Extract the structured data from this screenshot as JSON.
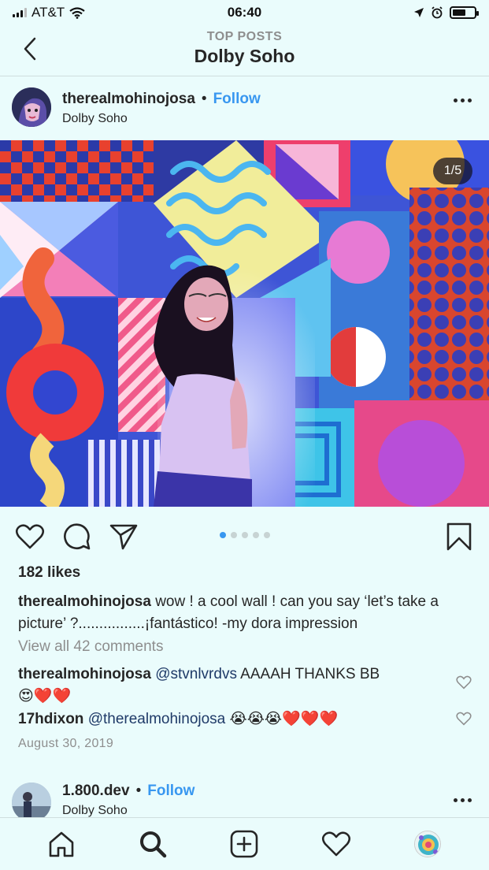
{
  "status": {
    "carrier": "AT&T",
    "time": "06:40",
    "battery_level": 0.6
  },
  "header": {
    "subtitle": "TOP POSTS",
    "title": "Dolby Soho"
  },
  "post": {
    "username": "therealmohinojosa",
    "separator": "•",
    "follow_label": "Follow",
    "location": "Dolby Soho",
    "image_counter": "1/5",
    "carousel_total": 5,
    "carousel_active": 1,
    "likes": "182 likes",
    "caption_user": "therealmohinojosa",
    "caption_text": " wow ! a cool wall ! can you say ‘let’s take a picture’ ?................¡fantástico! -my dora impression",
    "view_all": "View all 42 comments",
    "comments": [
      {
        "user": "therealmohinojosa",
        "mention": "@stvnlvrdvs",
        "text": " AAAAH THANKS BB",
        "emoji": "😍❤️❤️"
      },
      {
        "user": "17hdixon",
        "mention": "@therealmohinojosa",
        "text": " ",
        "emoji": "😭😭😭❤️❤️❤️"
      }
    ],
    "date": "August 30, 2019"
  },
  "next_post": {
    "username": "1.800.dev",
    "separator": "•",
    "follow_label": "Follow",
    "location": "Dolby Soho"
  },
  "colors": {
    "accent": "#3897f0",
    "background": "#eafcfc",
    "muted": "#8e8e8e"
  },
  "icons": [
    "back-arrow-icon",
    "more-icon",
    "heart-icon",
    "comment-icon",
    "share-icon",
    "bookmark-icon",
    "home-icon",
    "search-icon",
    "add-icon",
    "activity-heart-icon"
  ]
}
